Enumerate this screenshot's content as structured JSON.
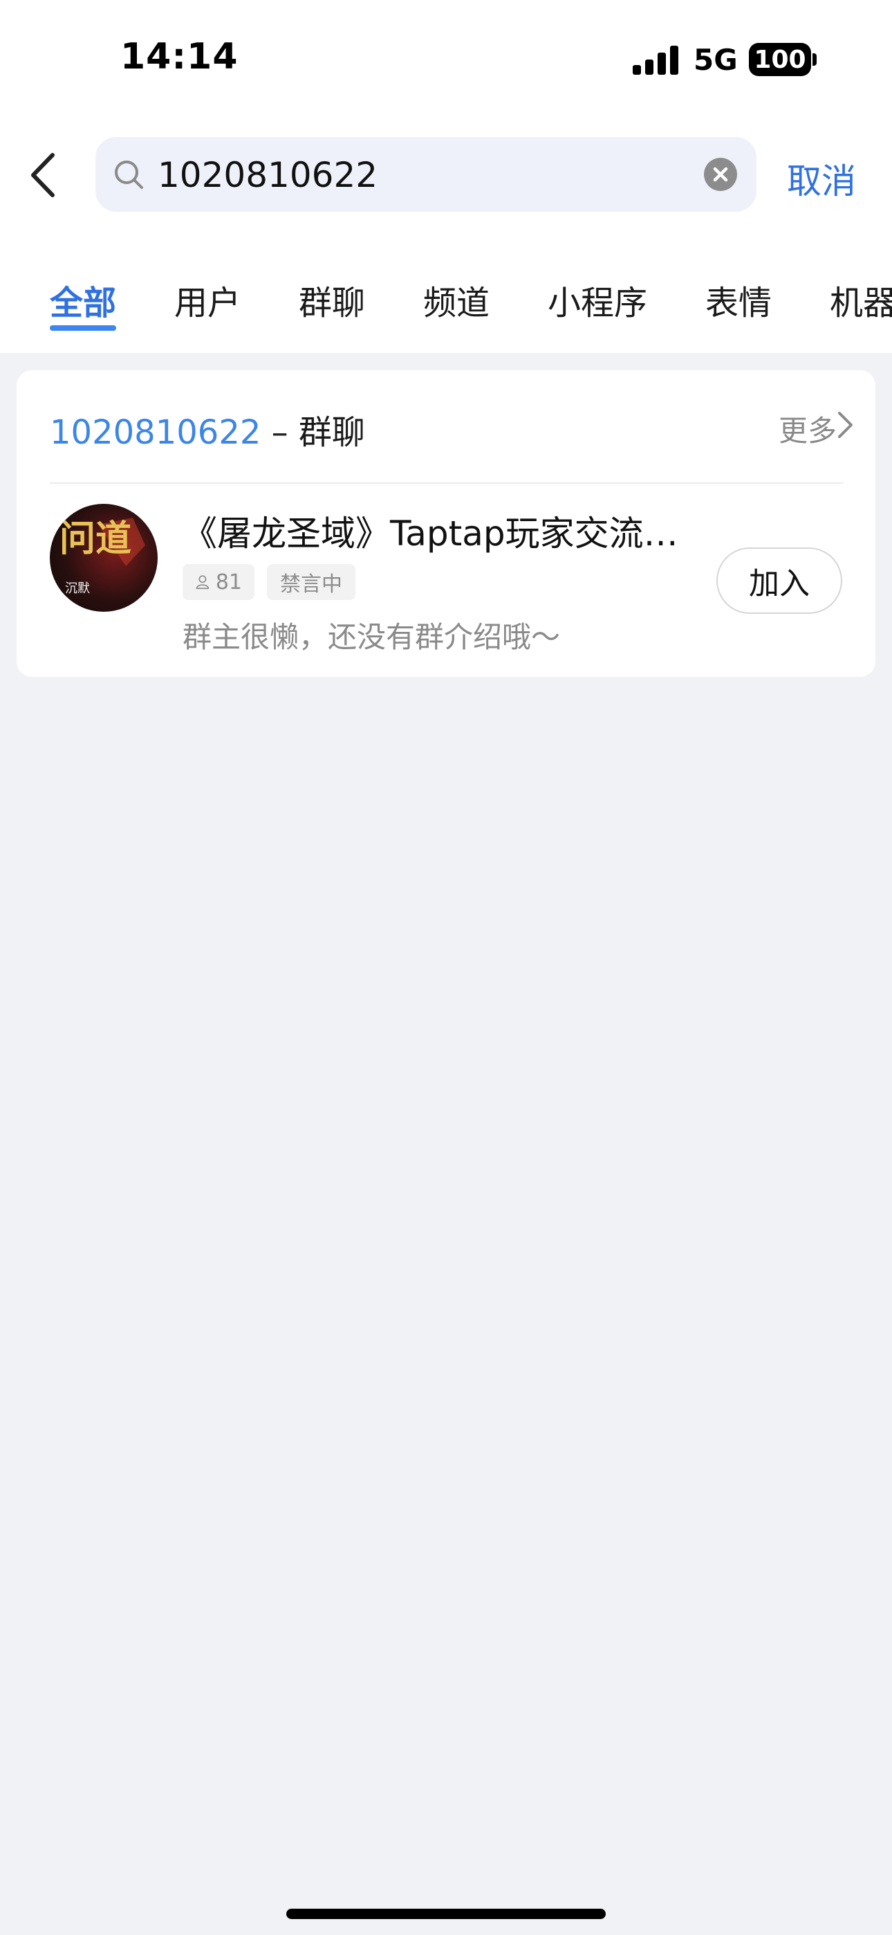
{
  "status_bar": {
    "time": "14:14",
    "network": "5G",
    "battery": "100"
  },
  "search": {
    "value": "1020810622",
    "cancel_label": "取消"
  },
  "tabs": [
    {
      "label": "全部",
      "active": true
    },
    {
      "label": "用户",
      "active": false
    },
    {
      "label": "群聊",
      "active": false
    },
    {
      "label": "频道",
      "active": false
    },
    {
      "label": "小程序",
      "active": false
    },
    {
      "label": "表情",
      "active": false
    },
    {
      "label": "机器",
      "active": false
    }
  ],
  "result_section": {
    "query": "1020810622",
    "separator": " – ",
    "type": "群聊",
    "more_label": "更多"
  },
  "group": {
    "name": "《屠龙圣域》Taptap玩家交流…",
    "member_count": "81",
    "mute_status": "禁言中",
    "description": "群主很懒，还没有群介绍哦～",
    "join_label": "加入",
    "avatar_text_main": "问道",
    "avatar_text_small": "沉默"
  },
  "colors": {
    "accent": "#2f71e0",
    "tab_underline": "#3d86f2",
    "query_highlight": "#3b86e6",
    "page_background": "#f1f2f5"
  }
}
